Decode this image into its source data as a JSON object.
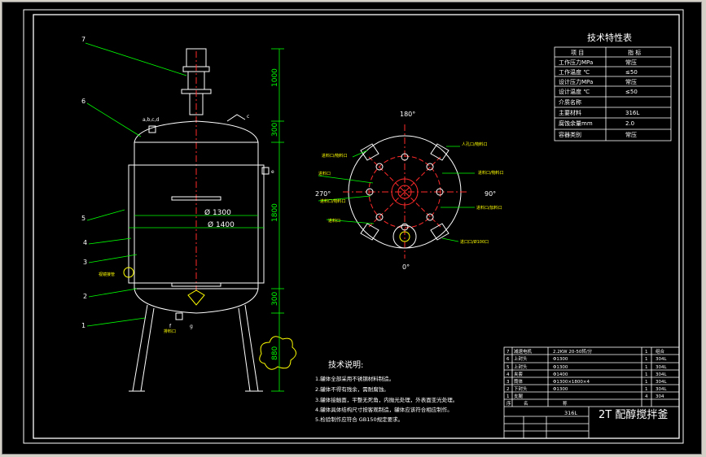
{
  "spec_table": {
    "title": "技术特性表",
    "header": [
      "项  目",
      "指  标"
    ],
    "rows": [
      [
        "工作压力MPa",
        "常压"
      ],
      [
        "工作温度 ℃",
        "≤50"
      ],
      [
        "设计压力MPa",
        "常压"
      ],
      [
        "设计温度 ℃",
        "≤50"
      ],
      [
        "介质名称",
        ""
      ],
      [
        "主要材料",
        "316L"
      ],
      [
        "腐蚀余量mm",
        "2.0"
      ],
      [
        "容器类别",
        "常压"
      ]
    ]
  },
  "tech_notes": {
    "title": "技术说明:",
    "items": [
      "1.罐体全部采用不锈钢材料制造。",
      "2.罐体不得有残余，需耐腐蚀。",
      "3.罐体接触面，平整无死角，内抛光处理，外表面亚光处理。",
      "4.罐体具体结构尺寸按客观制造，罐体应该符合相应制作。",
      "5.检验制作应符合 GB150规定要求。"
    ]
  },
  "parts_list": {
    "rows": [
      [
        "7",
        "减速电机",
        "2.2KW 20-50转/分",
        "1",
        "组合"
      ],
      [
        "6",
        "上封头",
        "Φ1300",
        "1",
        "304L"
      ],
      [
        "5",
        "上封头",
        "Φ1300",
        "1",
        "304L"
      ],
      [
        "4",
        "夹套",
        "Φ1400",
        "1",
        "304L"
      ],
      [
        "3",
        "筒体",
        "Φ1300×1800×4",
        "1",
        "304L"
      ],
      [
        "2",
        "下封头",
        "Φ1300",
        "1",
        "304L"
      ],
      [
        "1",
        "支腿",
        "",
        "4",
        "304"
      ]
    ],
    "col_headers": [
      "序",
      "名",
      "称"
    ],
    "material": "316L",
    "drawing_title": "2T 配醇搅拌釜"
  },
  "elevation": {
    "dims": [
      "1000",
      "300",
      "1800",
      "300",
      "880"
    ],
    "diameter_inner": "Ø 1300",
    "diameter_outer": "Ø 1400",
    "leaders": [
      "7",
      "6",
      "5",
      "4",
      "3",
      "2",
      "1"
    ],
    "nozzle_labels": [
      "a,b,c,d",
      "c",
      "e",
      "f",
      "g"
    ],
    "sight_label": "视镜接管",
    "drain_label": "排料口"
  },
  "plan": {
    "angles": [
      "180°",
      "270°",
      "90°",
      "0°"
    ],
    "labels_left": [
      "进料口/物料口",
      "进料口",
      "进料口/物料口",
      "进料口"
    ],
    "labels_right": [
      "人孔口/物料口",
      "进料口/物料口",
      "进料口/加料口",
      "进口口/Ø100口"
    ]
  },
  "colors": {
    "line": "#ffffff",
    "dim": "#00ff00",
    "center": "#ff2a2a",
    "leader": "#00ff00",
    "text": "#ffffff",
    "hatch": "#ffff00"
  }
}
